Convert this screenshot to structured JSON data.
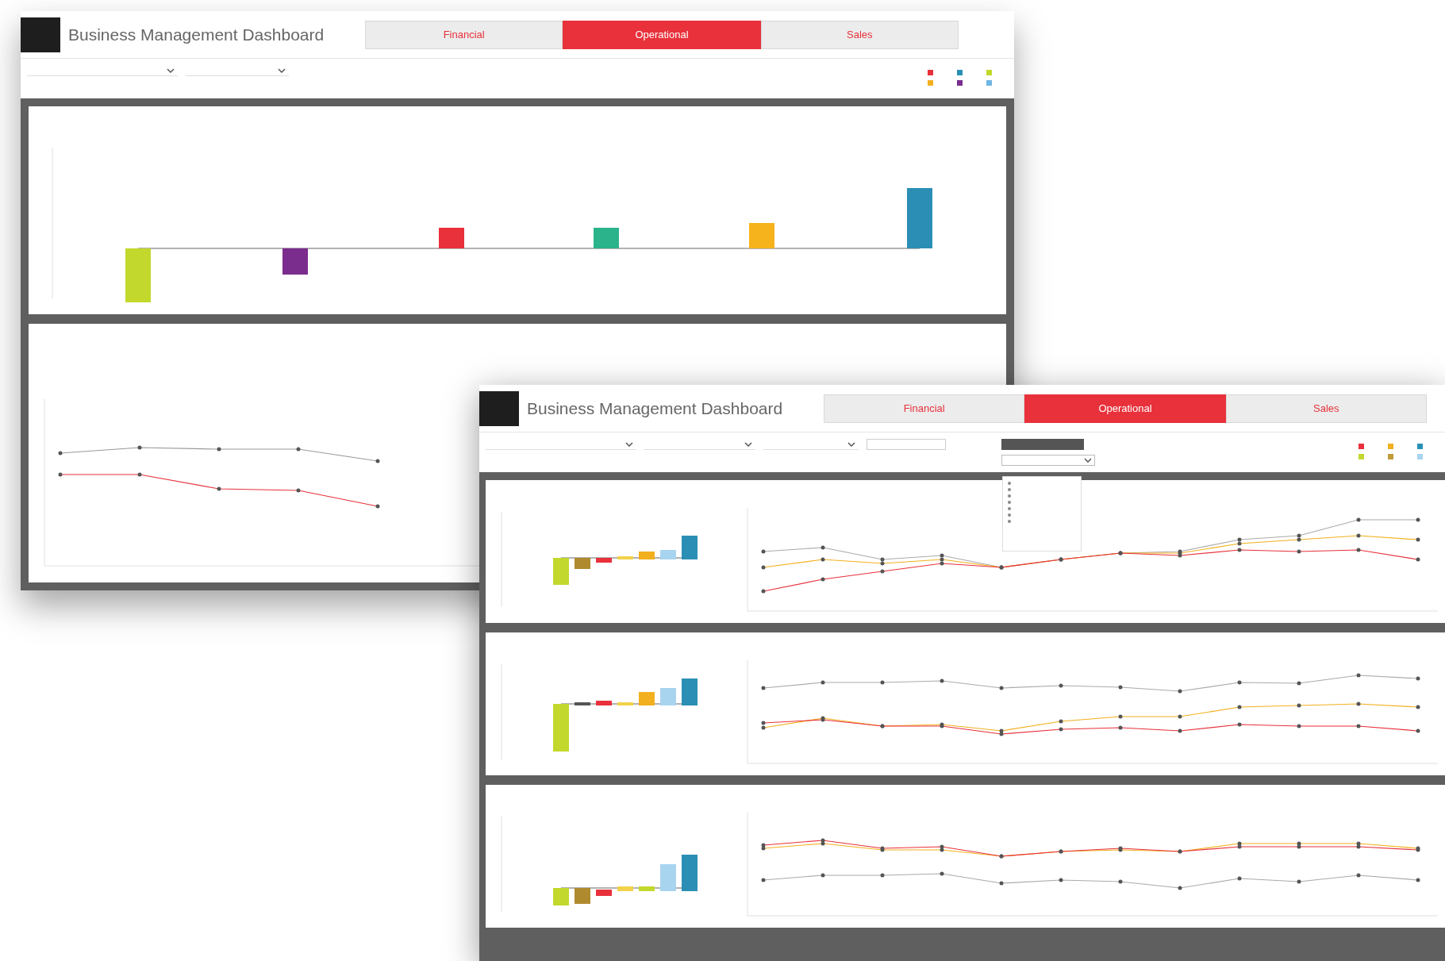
{
  "windows": [
    {
      "title": "Business Management Dashboard",
      "tabs": [
        {
          "label": "Financial",
          "selected": false
        },
        {
          "label": "Operational",
          "selected": true
        },
        {
          "label": "Sales",
          "selected": false
        }
      ]
    },
    {
      "title": "Business Management Dashboard",
      "tabs": [
        {
          "label": "Financial",
          "selected": false
        },
        {
          "label": "Operational",
          "selected": true
        },
        {
          "label": "Sales",
          "selected": false
        }
      ]
    }
  ]
}
